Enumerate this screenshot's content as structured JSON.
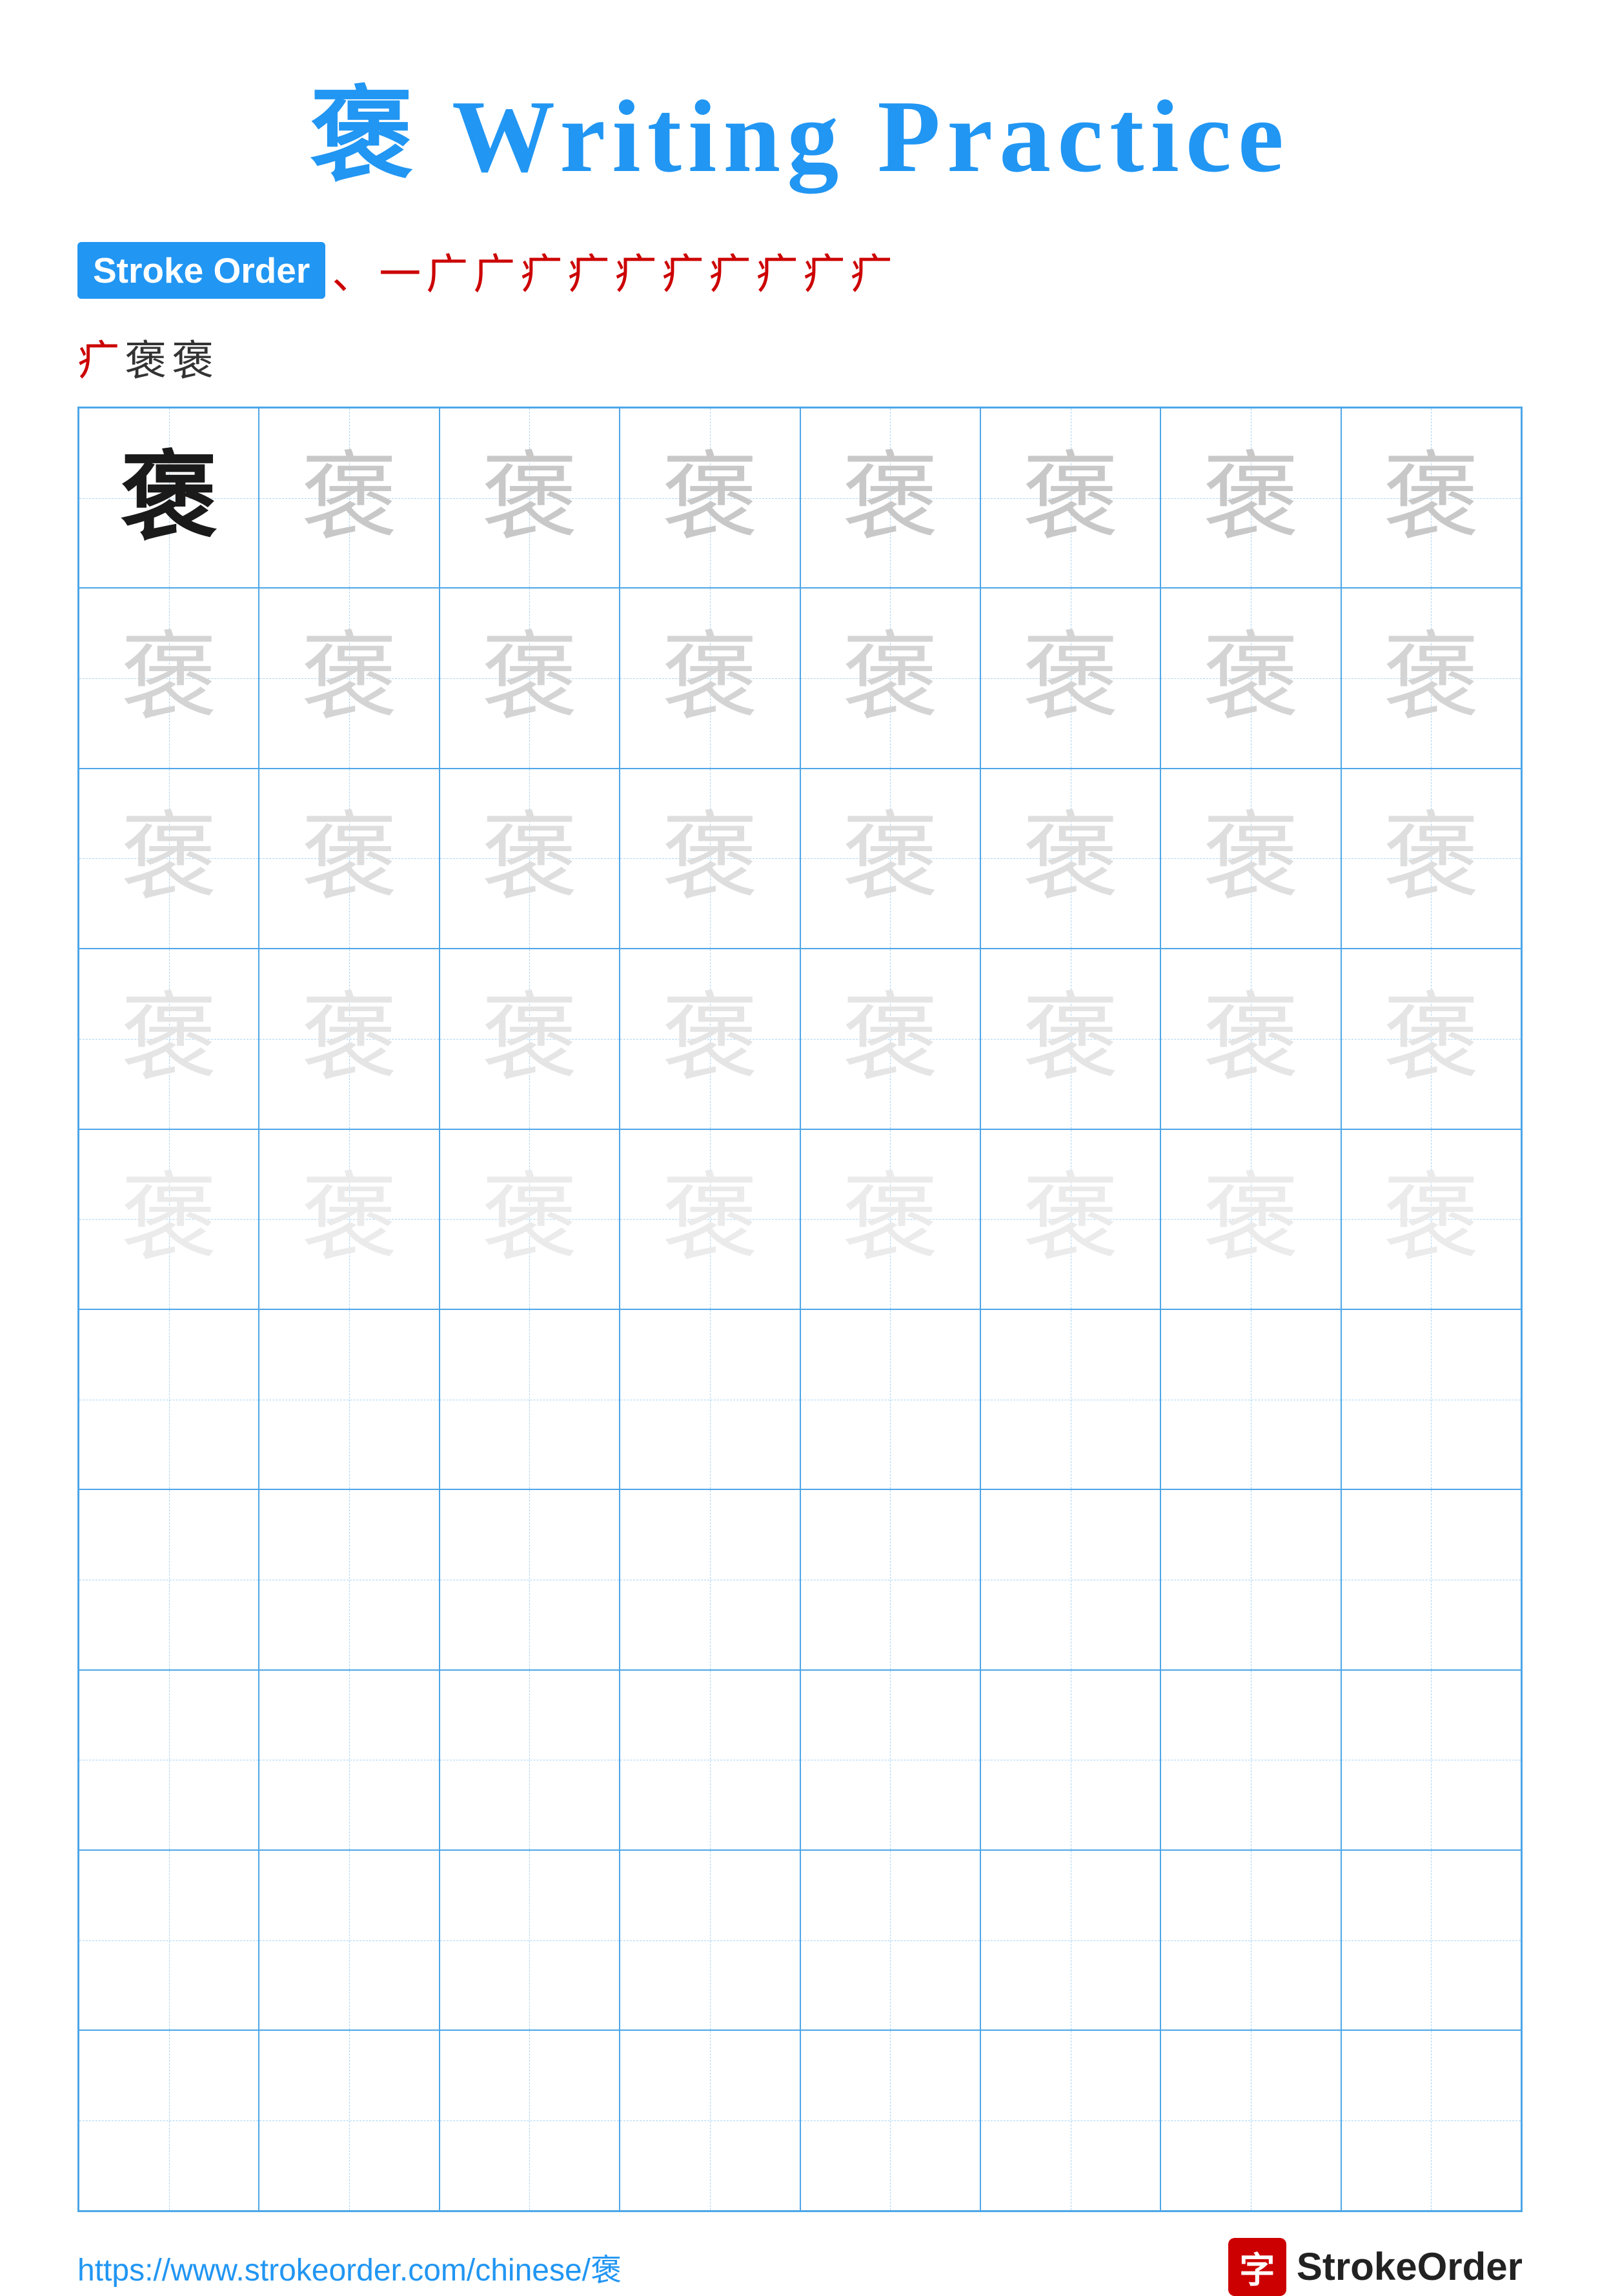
{
  "title": "褒 Writing Practice",
  "stroke_order": {
    "label": "Stroke Order",
    "chars_row1": [
      "、",
      "一",
      "广",
      "广",
      "疒",
      "疒",
      "疒",
      "疒",
      "疒",
      "疒",
      "疒",
      "疒"
    ],
    "chars_row2": [
      "疒",
      "褒",
      "褒"
    ]
  },
  "character": "褒",
  "grid": {
    "cols": 8,
    "rows": 10,
    "practice_rows": 5,
    "empty_rows": 5
  },
  "footer": {
    "url": "https://www.strokeorder.com/chinese/褒",
    "logo_char": "字",
    "logo_text": "StrokeOrder"
  }
}
